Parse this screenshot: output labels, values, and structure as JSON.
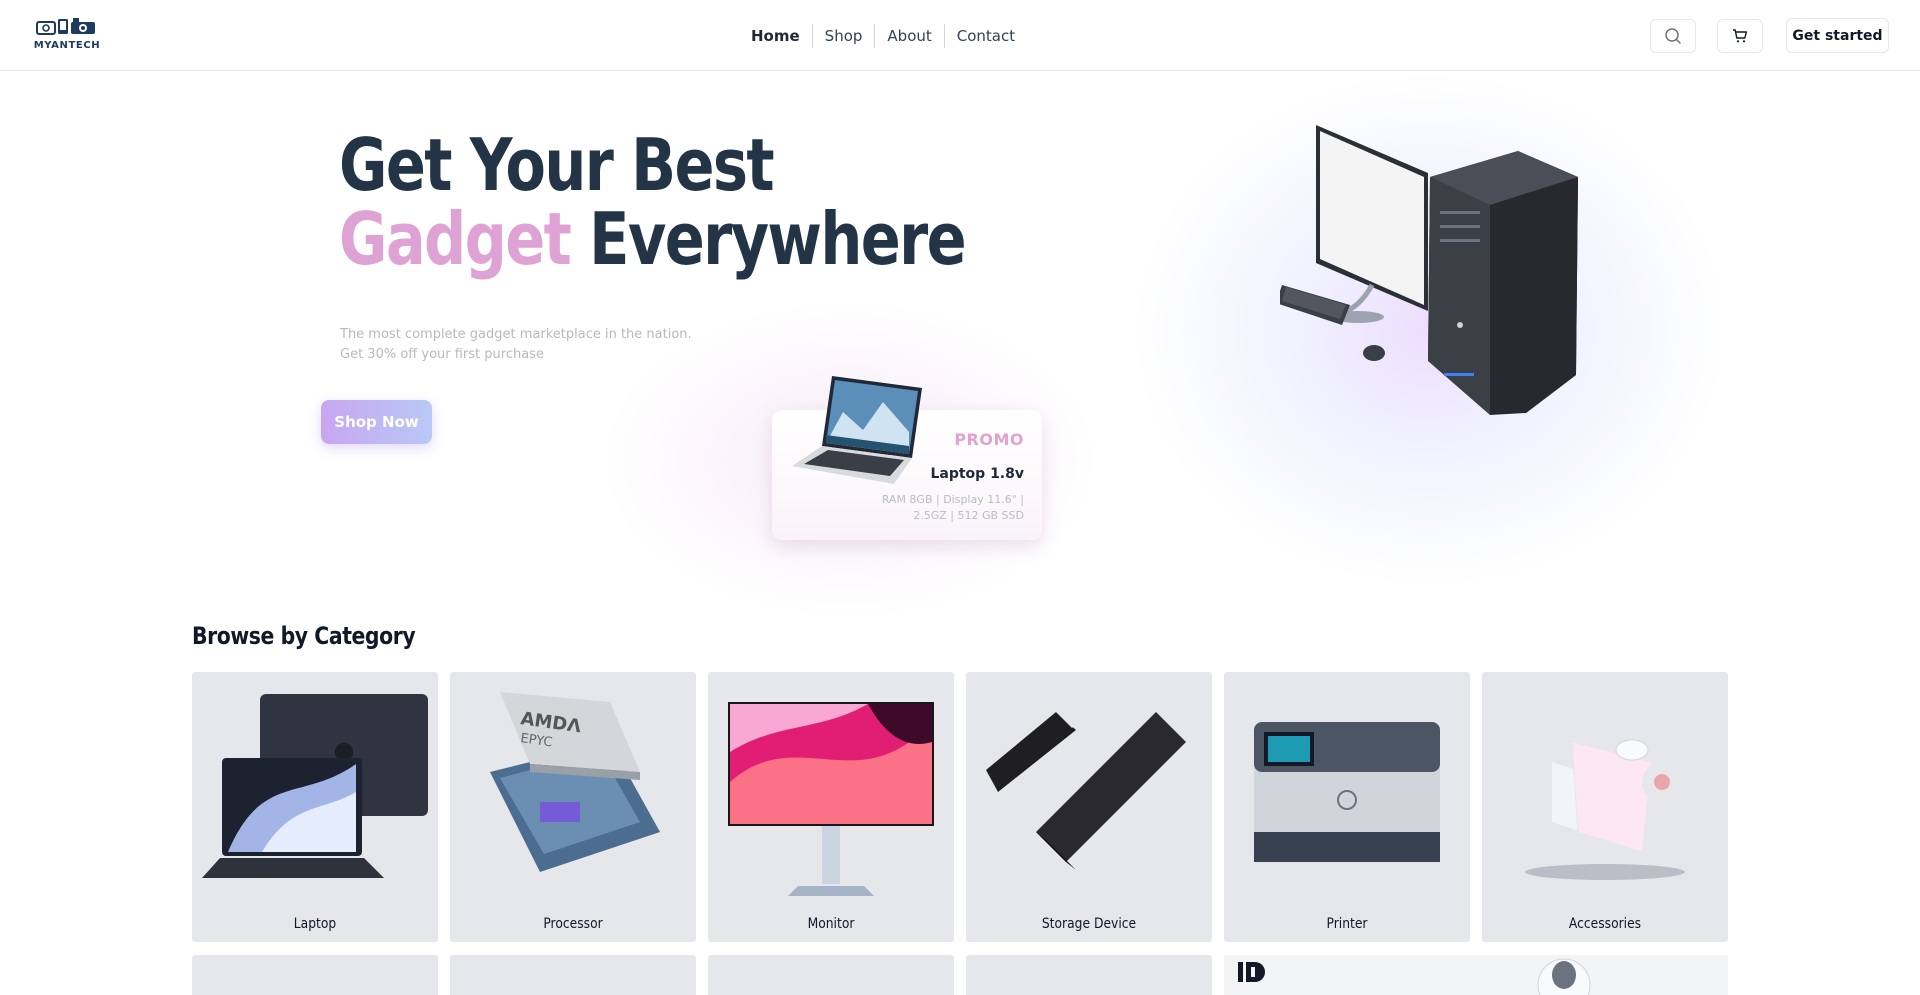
{
  "brand": {
    "name": "MYANTECH"
  },
  "nav": {
    "items": [
      {
        "label": "Home",
        "active": true
      },
      {
        "label": "Shop",
        "active": false
      },
      {
        "label": "About",
        "active": false
      },
      {
        "label": "Contact",
        "active": false
      }
    ],
    "search_icon": "search-icon",
    "cart_icon": "cart-icon",
    "cta_label": "Get started"
  },
  "hero": {
    "title_line1": "Get Your Best",
    "title_highlight": "Gadget",
    "title_rest": " Everywhere",
    "subtitle_line1": "The most complete gadget marketplace in the nation.",
    "subtitle_line2": "Get 30% off your first purchase",
    "cta_label": "Shop Now",
    "accent_color": "#dea3d4"
  },
  "promo": {
    "tag": "PROMO",
    "name": "Laptop 1.8v",
    "specs": "RAM 8GB | Display 11.6\" | 2.5GZ | 512 GB SSD"
  },
  "categories": {
    "title": "Browse by Category",
    "items": [
      {
        "label": "Laptop"
      },
      {
        "label": "Processor"
      },
      {
        "label": "Monitor"
      },
      {
        "label": "Storage Device"
      },
      {
        "label": "Printer"
      },
      {
        "label": "Accessories"
      }
    ]
  }
}
